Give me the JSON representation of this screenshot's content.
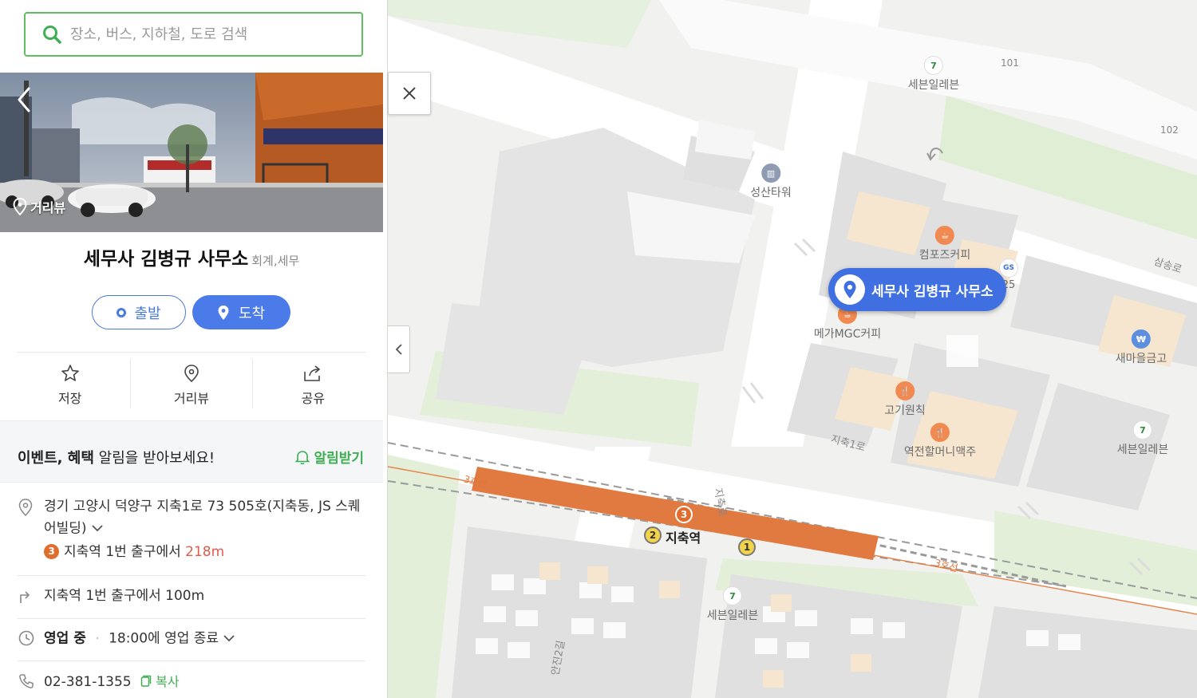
{
  "search": {
    "placeholder": "장소, 버스, 지하철, 도로 검색"
  },
  "streetview": {
    "label": "거리뷰"
  },
  "place": {
    "name": "세무사 김병규 사무소",
    "category": "회계,세무"
  },
  "route": {
    "depart": "출발",
    "arrive": "도착"
  },
  "actions": {
    "save": "저장",
    "streetview": "거리뷰",
    "share": "공유"
  },
  "event": {
    "bold": "이벤트, 혜택",
    "rest": " 알림을 받아보세요!",
    "notify": "알림받기"
  },
  "address": {
    "text": "경기 고양시 덕양구 지축1로 73 505호(지축동, JS 스퀘어빌딩)",
    "station_badge": "3",
    "station_text": "지축역 1번 출구에서",
    "station_dist": "218m"
  },
  "direction": {
    "text": "지축역 1번 출구에서 100m"
  },
  "hours": {
    "status": "영업 중",
    "text": "18:00에 영업 종료"
  },
  "phone": {
    "number": "02-381-1355",
    "copy": "복사"
  },
  "map": {
    "marker_label": "세무사 김병규 사무소",
    "station_name": "지축역",
    "pois": {
      "seven1": "세븐일레븐",
      "seven2": "세븐일레븐",
      "seven3": "세븐일레븐",
      "seongsan": "성산타워",
      "compose": "컴포즈커피",
      "mega": "메가MGC커피",
      "gogi": "고기원칙",
      "yeokjeon": "역전할머니맥주",
      "saemaul": "새마을금고",
      "gs25": "GS25"
    },
    "labels": {
      "jichuk1ro": "지축1로",
      "jichukro": "지축로",
      "samsongro": "삼송로",
      "anjin2gil": "안진2길",
      "line3a": "3호선",
      "line3b": "3호선",
      "b101": "101",
      "b102": "102",
      "gs_num": "25"
    },
    "exits": {
      "e1": "1",
      "e2": "2",
      "line3": "3"
    }
  },
  "colors": {
    "accent_blue": "#3f6fe0",
    "green": "#3fae54",
    "line3_orange": "#e06d2e"
  }
}
